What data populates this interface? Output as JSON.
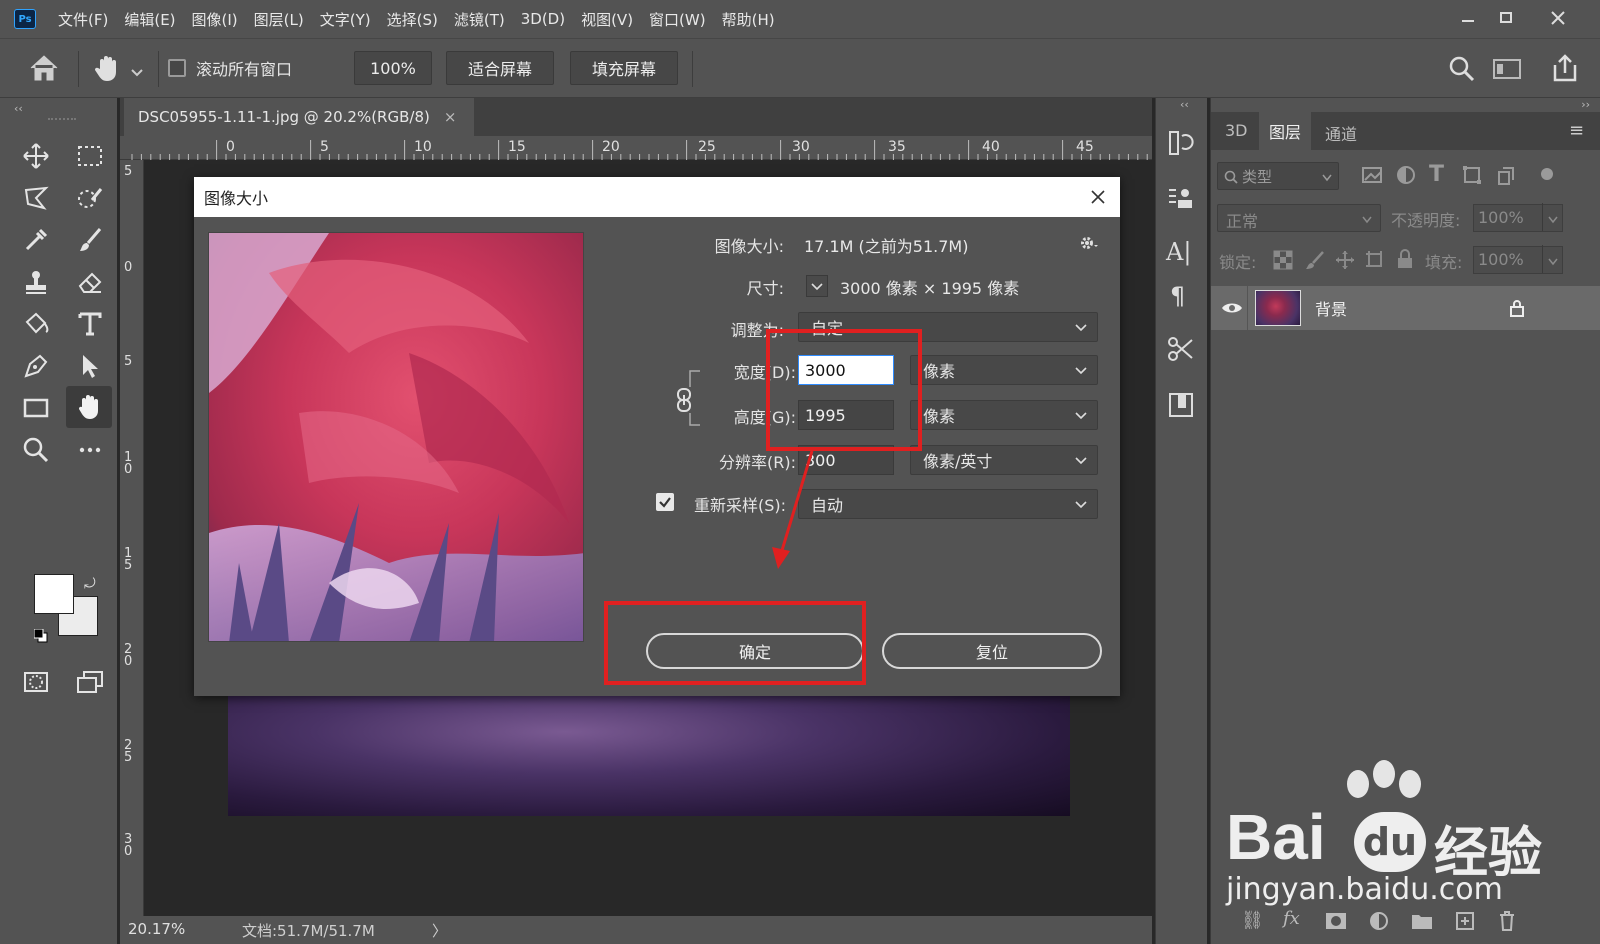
{
  "app": {
    "logo": "Ps"
  },
  "menubar": {
    "items": [
      "文件(F)",
      "编辑(E)",
      "图像(I)",
      "图层(L)",
      "文字(Y)",
      "选择(S)",
      "滤镜(T)",
      "3D(D)",
      "视图(V)",
      "窗口(W)",
      "帮助(H)"
    ]
  },
  "options_bar": {
    "scroll_all_label": "滚动所有窗口",
    "zoom_button": "100%",
    "fit_screen_button": "适合屏幕",
    "fill_screen_button": "填充屏幕"
  },
  "document": {
    "tab_title": "DSC05955-1.11-1.jpg @ 20.2%(RGB/8)",
    "ruler_top_labels": [
      "0",
      "5",
      "10",
      "15",
      "20",
      "25",
      "30",
      "35",
      "40",
      "45"
    ],
    "ruler_left_labels": [
      "5",
      "0",
      "5",
      "1 0",
      "1 5",
      "2 0",
      "2 5",
      "3 0"
    ],
    "zoom_status": "20.17%",
    "doc_status": "文档:51.7M/51.7M",
    "status_arrow": "〉"
  },
  "dialog": {
    "title": "图像大小",
    "image_size_label": "图像大小:",
    "image_size_value": "17.1M (之前为51.7M)",
    "dimensions_label": "尺寸:",
    "dimensions_value": "3000  像素  ×  1995  像素",
    "fit_to_label": "调整为:",
    "fit_to_value": "自定",
    "width_label": "宽度(D):",
    "width_value": "3000",
    "width_unit": "像素",
    "height_label": "高度(G):",
    "height_value": "1995",
    "height_unit": "像素",
    "resolution_label": "分辨率(R):",
    "resolution_value": "300",
    "resolution_unit": "像素/英寸",
    "resample_label": "重新采样(S):",
    "resample_value": "自动",
    "ok_button": "确定",
    "reset_button": "复位"
  },
  "layers_panel": {
    "tabs": [
      "3D",
      "图层",
      "通道"
    ],
    "active_tab": "图层",
    "filter_placeholder": "类型",
    "blend_mode": "正常",
    "opacity_label": "不透明度:",
    "opacity_value": "100%",
    "lock_label": "锁定:",
    "fill_label": "填充:",
    "fill_value": "100%",
    "layer_name": "背景"
  },
  "watermark": {
    "brand": "Bai",
    "brand_du": "du",
    "brand_cn": "经验",
    "url": "jingyan.baidu.com"
  },
  "colors": {
    "highlight_red": "#e02020",
    "panel_bg": "#535353",
    "canvas_bg": "#282828",
    "accent_blue": "#31a8ff"
  }
}
